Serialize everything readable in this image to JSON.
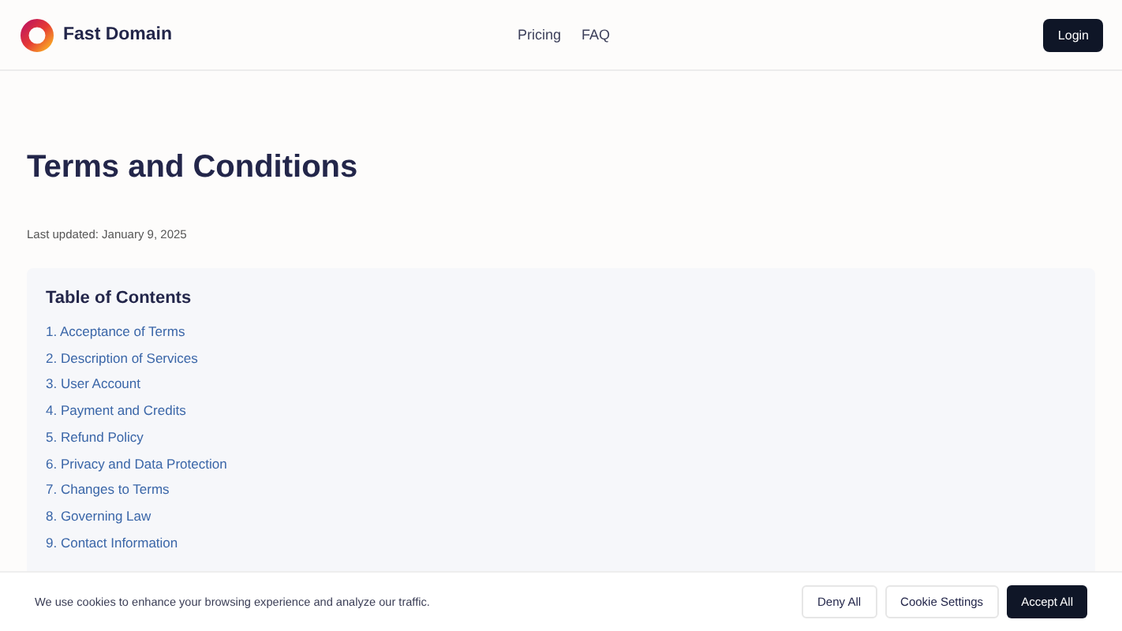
{
  "header": {
    "brand": "Fast Domain",
    "nav": [
      "Pricing",
      "FAQ"
    ],
    "login": "Login"
  },
  "page": {
    "title": "Terms and Conditions",
    "updated": "Last updated: January 9, 2025"
  },
  "toc": {
    "title": "Table of Contents",
    "items": [
      "1. Acceptance of Terms",
      "2. Description of Services",
      "3. User Account",
      "4. Payment and Credits",
      "5. Refund Policy",
      "6. Privacy and Data Protection",
      "7. Changes to Terms",
      "8. Governing Law",
      "9. Contact Information"
    ]
  },
  "cookie": {
    "text": "We use cookies to enhance your browsing experience and analyze our traffic.",
    "buttons": [
      {
        "label": "Deny All",
        "kind": "secondary"
      },
      {
        "label": "Cookie Settings",
        "kind": "secondary"
      },
      {
        "label": "Accept All",
        "kind": "primary"
      }
    ]
  }
}
